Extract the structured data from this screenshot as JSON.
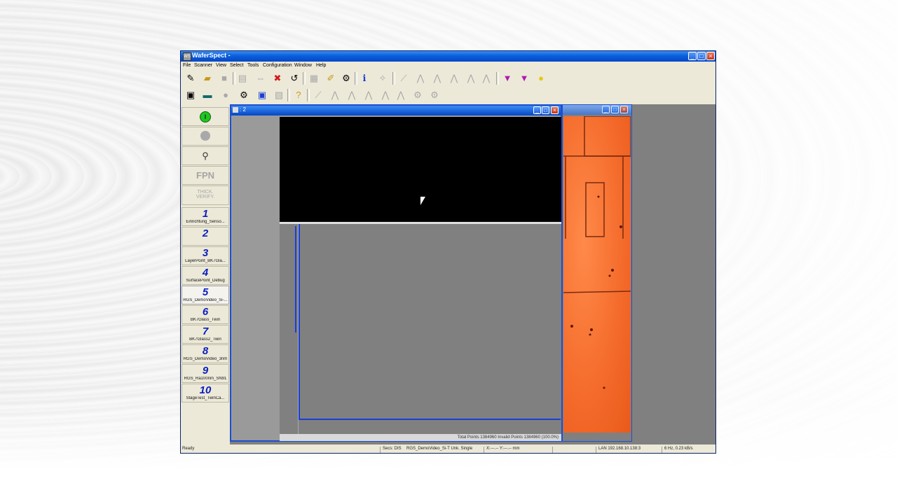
{
  "app": {
    "title": "WaferSpect -",
    "icon_label": "WS"
  },
  "menu": [
    "File",
    "Scanner",
    "View",
    "Select",
    "Tools",
    "Configuration",
    "Window",
    "Help"
  ],
  "left_panel": {
    "fpn_label": "FPN",
    "thick_line1": "THICK.",
    "thick_line2": "VERIFY.",
    "presets": [
      {
        "num": "1",
        "label": "Einrichtung_Senso..."
      },
      {
        "num": "2",
        "label": ""
      },
      {
        "num": "3",
        "label": "LayerPoint_BK7Gla..."
      },
      {
        "num": "4",
        "label": "SurfacePoint_Debug"
      },
      {
        "num": "5",
        "label": "RGS_DemoVideo_Si-..."
      },
      {
        "num": "6",
        "label": "BK7Glass_Twin"
      },
      {
        "num": "7",
        "label": "BK7Glass2_Twin"
      },
      {
        "num": "8",
        "label": "RGS_DemoVideo_3nm"
      },
      {
        "num": "9",
        "label": "RGS_Ra100nm_SN91"
      },
      {
        "num": "10",
        "label": "StageTest_TwinCa..."
      }
    ]
  },
  "child_window": {
    "title": ": 2",
    "status": "Total Points 1384960  Invalid Points 1384960 (100.0%)"
  },
  "statusbar": {
    "ready": "Ready",
    "secs": "Secs: DIS",
    "mode": "RGS_DemoVideo_Si-T Unk. Single",
    "coords": "X:---.-- Y:---.-- mm",
    "lan": "LAN 192.168.10.138:3",
    "rate": "6 Hz, 0.23 kB/s"
  },
  "icons": {
    "toolbar1": [
      "new-wizard-icon",
      "open-folder-icon",
      "save-icon",
      "print-icon",
      "link-icon",
      "disconnect-icon",
      "reset-icon",
      "layout-icon",
      "pencil-icon",
      "settings-icon",
      "info-icon",
      "measure-icon",
      "chart-icon",
      "peak-icon",
      "peak2-icon",
      "peak3-icon",
      "peak4-icon",
      "peak5-icon",
      "gem-icon",
      "gem2-icon",
      "bulb-icon"
    ],
    "toolbar2": [
      "properties-icon",
      "monitor-icon",
      "record-icon",
      "gear-person-icon",
      "capture-icon",
      "frame-icon",
      "help-icon"
    ]
  },
  "colors": {
    "accent": "#0547c6",
    "preset_blue": "#0a1fbf",
    "video_bg": "#000000",
    "micro_orange": "#f46a2a"
  }
}
